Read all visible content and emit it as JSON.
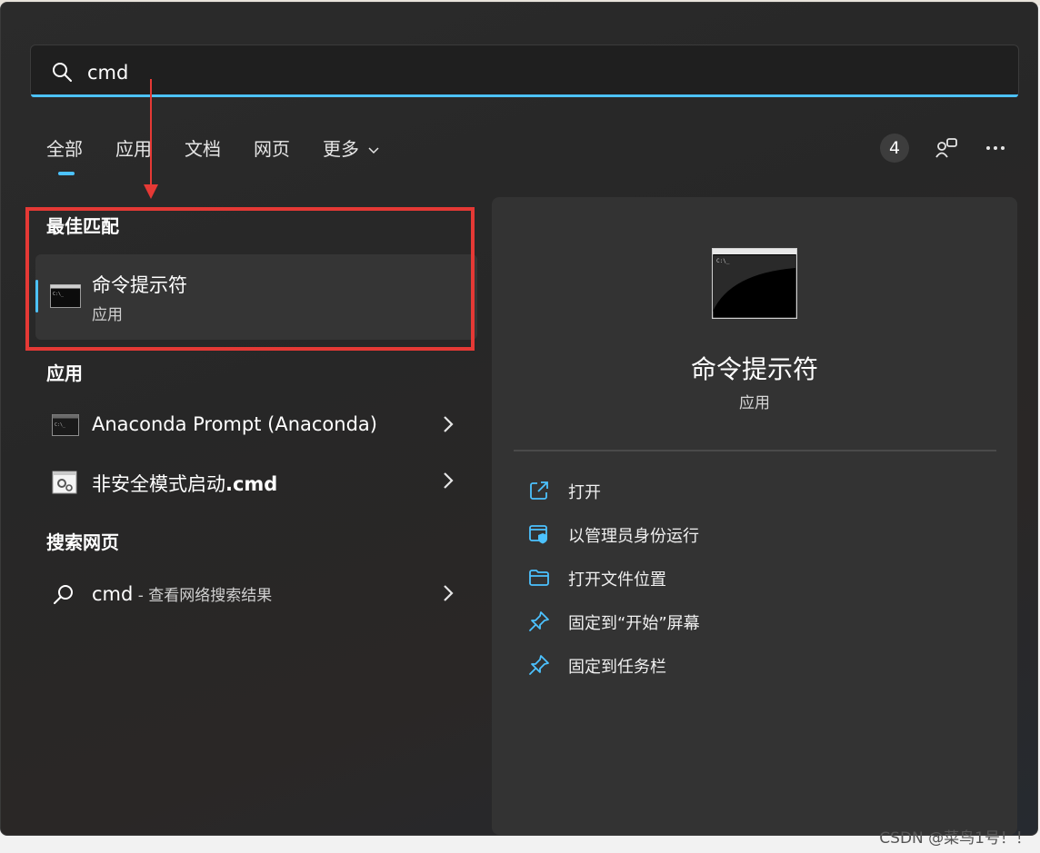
{
  "search": {
    "value": "cmd"
  },
  "tabs": [
    {
      "label": "全部"
    },
    {
      "label": "应用"
    },
    {
      "label": "文档"
    },
    {
      "label": "网页"
    },
    {
      "label": "更多"
    }
  ],
  "header": {
    "badge": "4"
  },
  "best_match": {
    "section_title": "最佳匹配",
    "title": "命令提示符",
    "subtitle": "应用"
  },
  "apps": {
    "section_title": "应用",
    "items": [
      {
        "label": "Anaconda Prompt (Anaconda)"
      },
      {
        "label_prefix": "非安全模式启动",
        "label_bold": ".cmd"
      }
    ]
  },
  "web": {
    "section_title": "搜索网页",
    "query": "cmd",
    "suffix": " - 查看网络搜索结果"
  },
  "detail": {
    "title": "命令提示符",
    "subtitle": "应用",
    "actions": [
      {
        "label": "打开",
        "icon": "open-external-icon"
      },
      {
        "label": "以管理员身份运行",
        "icon": "admin-shield-icon"
      },
      {
        "label": "打开文件位置",
        "icon": "folder-icon"
      },
      {
        "label": "固定到“开始”屏幕",
        "icon": "pin-icon"
      },
      {
        "label": "固定到任务栏",
        "icon": "pin-icon"
      }
    ]
  },
  "watermark": "CSDN @菜鸟1号！！",
  "colors": {
    "accent": "#4cc2ff",
    "annotation": "#e53935"
  }
}
